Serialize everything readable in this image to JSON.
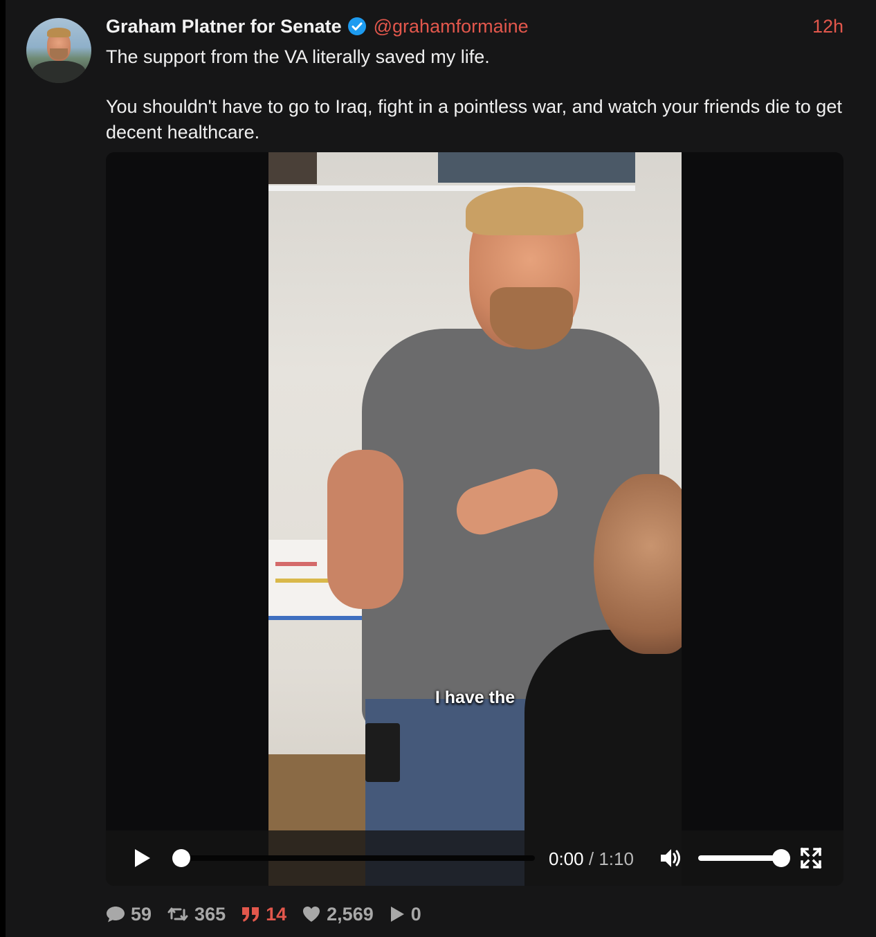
{
  "post": {
    "author_name": "Graham Platner for Senate",
    "handle": "@grahamformaine",
    "time_ago": "12h",
    "verified": true,
    "text_line1": "The support from the VA literally saved my life.",
    "text_line2": "You shouldn't have to go to Iraq, fight in a pointless war, and watch your friends die to get decent healthcare."
  },
  "video": {
    "caption": "I have the",
    "current_time": "0:00",
    "separator": "/",
    "duration": "1:10",
    "progress_fraction": 0,
    "volume_fraction": 1.0
  },
  "stats": {
    "replies": "59",
    "reposts": "365",
    "quotes": "14",
    "likes": "2,569",
    "views": "0"
  },
  "icons": {
    "verified": "verified-badge-icon",
    "play": "play-icon",
    "volume": "volume-icon",
    "fullscreen": "fullscreen-icon",
    "reply": "comment-icon",
    "repost": "repost-icon",
    "quote": "quote-icon",
    "like": "heart-icon",
    "views": "play-views-icon"
  },
  "colors": {
    "accent": "#e2574c",
    "verified": "#1d9bf0",
    "background": "#161617",
    "text": "#f0f0f0",
    "muted": "#a8a8a8"
  }
}
